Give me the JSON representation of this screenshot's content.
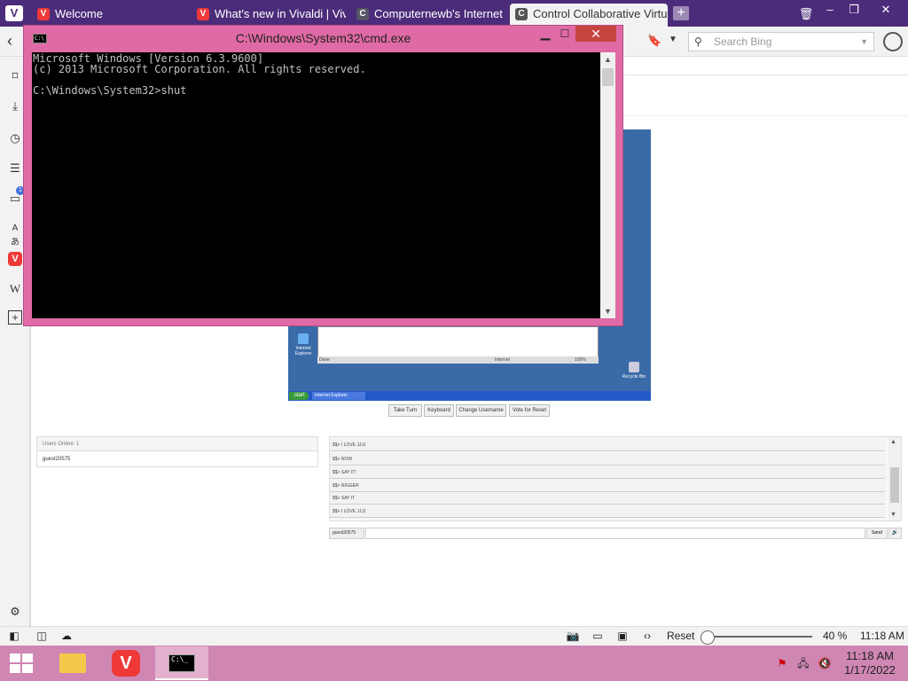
{
  "browser": {
    "menu_icon": "vivaldi-logo-icon",
    "tabs": [
      {
        "label": "Welcome",
        "icon": "V"
      },
      {
        "label": "What's new in Vivaldi | Vival",
        "icon": "V"
      },
      {
        "label": "Computernewb's Internet P",
        "icon": "C"
      },
      {
        "label": "Control Collaborative Virtu",
        "icon": "C"
      }
    ],
    "search_placeholder": "Search Bing",
    "window_buttons": {
      "minimize": "–",
      "restore": "❐",
      "close": "✕"
    }
  },
  "sidebar_icons": [
    "bookmark-icon",
    "download-icon",
    "history-icon",
    "notes-icon",
    "window-panel-icon",
    "translate-icon",
    "vivaldi-icon",
    "wikipedia-icon",
    "add-panel-icon",
    "settings-icon"
  ],
  "sidebar_badge": "1",
  "vm": {
    "desktop_icons": [
      "Internet Explorer",
      "Recycle Bin"
    ],
    "ie_status_left": "Done",
    "ie_status_zone": "Internet",
    "ie_zoom": "100%",
    "start_label": "start",
    "task_label": "Internet Explorer",
    "controls": [
      "Take Turn",
      "Keyboard",
      "Change Username",
      "Vote for Reset"
    ]
  },
  "users": {
    "header": "Users Online: 1",
    "list": [
      "guest20575"
    ]
  },
  "chat": {
    "messages": [
      "$$> I LOVE JJJJ",
      "$$> NOW",
      "$$> SAY IT!",
      "$$> NIGGER",
      "$$> SAY IT",
      "$$> I LOVE JJJJ"
    ],
    "username": "guest20575",
    "send_label": "Send",
    "sound_icon": "speaker-icon"
  },
  "statusbar": {
    "reset_label": "Reset",
    "zoom_level": "40 %",
    "time": "11:18 AM"
  },
  "cmd": {
    "title": "C:\\Windows\\System32\\cmd.exe",
    "console_lines": [
      "Microsoft Windows [Version 6.3.9600]",
      "(c) 2013 Microsoft Corporation. All rights reserved.",
      "",
      "C:\\Windows\\System32>shut"
    ],
    "min": "▁",
    "max": "☐",
    "close": "✕"
  },
  "taskbar": {
    "clock_time": "11:18 AM",
    "clock_date": "1/17/2022"
  }
}
